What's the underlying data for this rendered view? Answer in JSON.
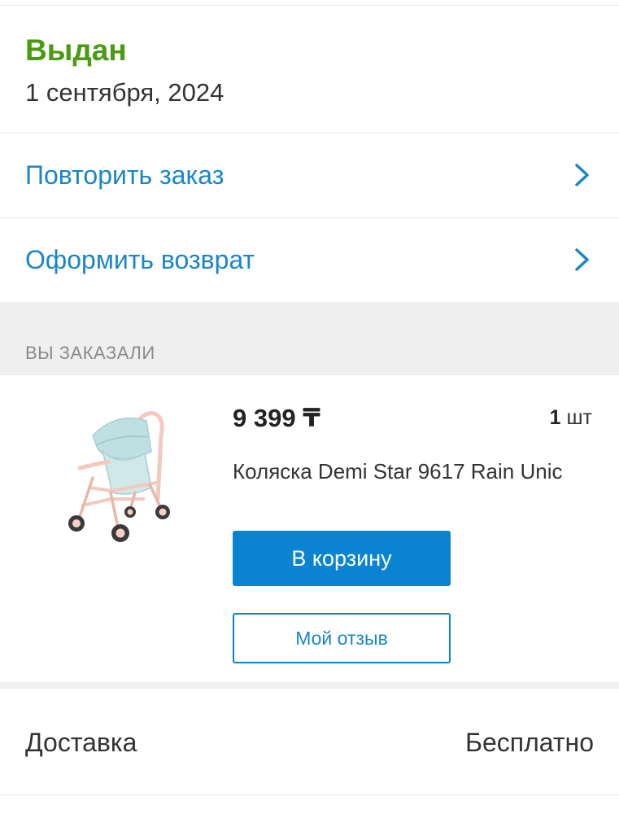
{
  "order": {
    "status": "Выдан",
    "date": "1 сентября, 2024",
    "status_color": "#4a9a12"
  },
  "actions": [
    {
      "label": "Повторить заказ",
      "icon": "chevron-right-icon"
    },
    {
      "label": "Оформить возврат",
      "icon": "chevron-right-icon"
    }
  ],
  "ordered_section": {
    "title": "ВЫ ЗАКАЗАЛИ"
  },
  "product": {
    "image": "stroller-image",
    "price": "9 399 ₸",
    "qty_number": "1",
    "qty_unit": "шт",
    "name": "Коляска Demi Star 9617 Rain Unic",
    "cart_button": "В корзину",
    "review_button": "Мой отзыв"
  },
  "delivery": {
    "label": "Доставка",
    "value": "Бесплатно"
  },
  "colors": {
    "accent": "#0a84d0",
    "link": "#1a86c8",
    "section_bg": "#efefef"
  }
}
